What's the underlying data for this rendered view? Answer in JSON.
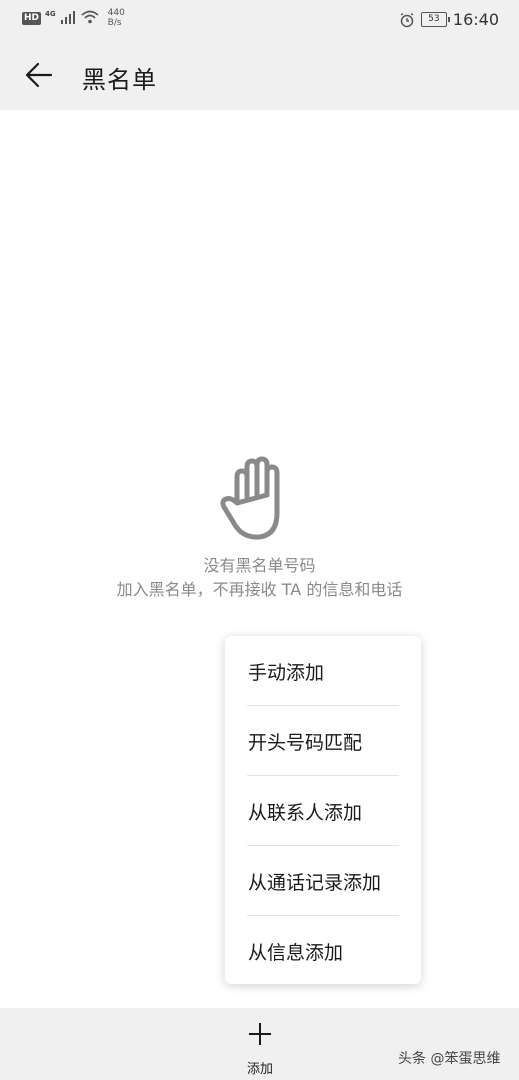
{
  "statusbar": {
    "hd": "HD",
    "network": "4G",
    "speed_value": "440",
    "speed_unit": "B/s",
    "battery": "53",
    "time": "16:40",
    "icons": [
      "signal-icon",
      "wifi-icon",
      "alarm-icon",
      "battery-icon"
    ]
  },
  "appbar": {
    "title": "黑名单",
    "back_icon": "arrow-left-icon"
  },
  "empty_state": {
    "icon": "hand-icon",
    "title": "没有黑名单号码",
    "subtitle": "加入黑名单，不再接收 TA 的信息和电话"
  },
  "menu": {
    "items": [
      {
        "label": "手动添加"
      },
      {
        "label": "开头号码匹配"
      },
      {
        "label": "从联系人添加"
      },
      {
        "label": "从通话记录添加"
      },
      {
        "label": "从信息添加"
      }
    ]
  },
  "bottom": {
    "add_label": "添加",
    "add_icon": "plus-icon"
  },
  "watermark": "头条 @笨蛋思维"
}
